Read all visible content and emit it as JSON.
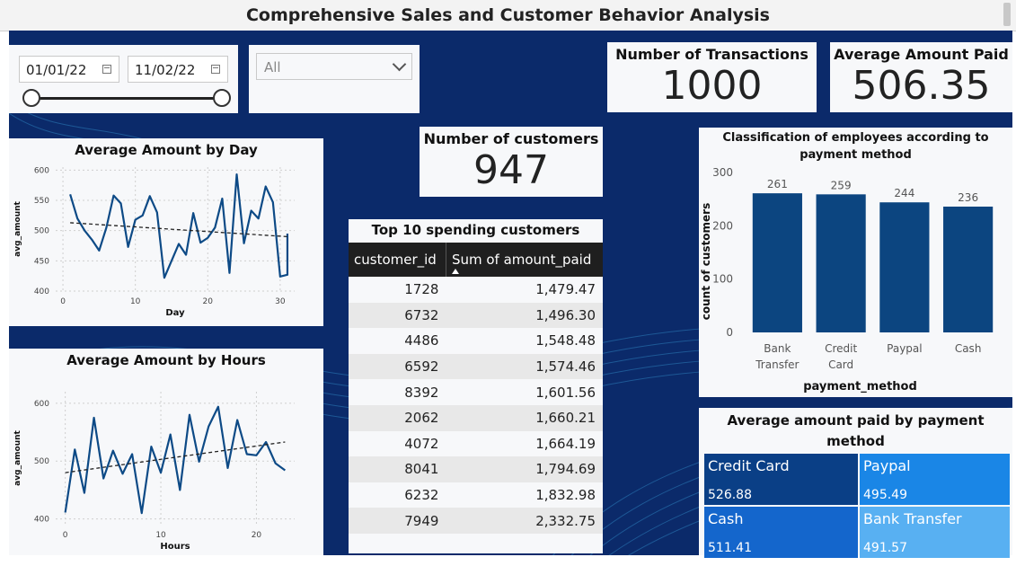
{
  "title": "Comprehensive Sales and Customer Behavior Analysis",
  "colors": {
    "background": "#0b2a6a",
    "series": "#0d4a86",
    "bar": "#0c4580"
  },
  "slicer": {
    "start_date": "01/01/22",
    "end_date": "11/02/22",
    "range_start": 0,
    "range_end": 1,
    "dropdown_value": "All",
    "icons": [
      "calendar-icon",
      "chevron-down-icon"
    ]
  },
  "kpis": {
    "transactions": {
      "label": "Number of Transactions",
      "value": "1000"
    },
    "avg_paid": {
      "label": "Average Amount Paid",
      "value": "506.35"
    },
    "customers": {
      "label": "Number of customers",
      "value": "947"
    }
  },
  "chart_day": {
    "title": "Average Amount by Day",
    "xlabel": "Day",
    "ylabel": "avg_amount",
    "xticks": [
      "0",
      "10",
      "20",
      "30"
    ],
    "yticks": [
      "400",
      "450",
      "500",
      "550",
      "600"
    ]
  },
  "chart_hours": {
    "title": "Average Amount by Hours",
    "xlabel": "Hours",
    "ylabel": "avg_amount",
    "xticks": [
      "0",
      "10",
      "20"
    ],
    "yticks": [
      "400",
      "500",
      "600"
    ]
  },
  "chart_payment": {
    "title": "Classification of employees according to payment method",
    "xlabel": "payment_method",
    "ylabel": "count of customers",
    "yticks": [
      "0",
      "100",
      "200",
      "300"
    ]
  },
  "table": {
    "title": "Top 10 spending customers",
    "headers": [
      "customer_id",
      "Sum of amount_paid"
    ],
    "sort_icon": "sort-ascending-icon",
    "rows": [
      [
        "1728",
        "1,479.47"
      ],
      [
        "6732",
        "1,496.30"
      ],
      [
        "4486",
        "1,548.48"
      ],
      [
        "6592",
        "1,574.46"
      ],
      [
        "8392",
        "1,601.56"
      ],
      [
        "2062",
        "1,660.21"
      ],
      [
        "4072",
        "1,664.19"
      ],
      [
        "8041",
        "1,794.69"
      ],
      [
        "6232",
        "1,832.98"
      ],
      [
        "7949",
        "2,332.75"
      ]
    ]
  },
  "treemap": {
    "title": "Average amount paid by payment method",
    "tiles": [
      {
        "label": "Credit Card",
        "value": "526.88",
        "color": "#0a3f86"
      },
      {
        "label": "Paypal",
        "value": "495.49",
        "color": "#1a86e6"
      },
      {
        "label": "Cash",
        "value": "511.41",
        "color": "#1466cc"
      },
      {
        "label": "Bank Transfer",
        "value": "491.57",
        "color": "#58b0f2"
      }
    ]
  },
  "chart_data": [
    {
      "type": "line",
      "title": "Average Amount by Day",
      "xlabel": "Day",
      "ylabel": "avg_amount",
      "xlim": [
        -1,
        32
      ],
      "ylim": [
        400,
        605
      ],
      "trendline": [
        [
          1,
          513
        ],
        [
          31,
          490
        ]
      ],
      "x": [
        1,
        2,
        3,
        4,
        5,
        6,
        7,
        8,
        9,
        10,
        11,
        12,
        13,
        14,
        15,
        16,
        17,
        18,
        19,
        20,
        21,
        22,
        23,
        24,
        25,
        26,
        27,
        28,
        29,
        30,
        31
      ],
      "series": [
        {
          "values": [
            560,
            520,
            500,
            485,
            467,
            505,
            558,
            545,
            473,
            518,
            525,
            557,
            530,
            422,
            450,
            478,
            460,
            529,
            480,
            488,
            505,
            553,
            430,
            593,
            479,
            533,
            520,
            573,
            547,
            424,
            427,
            495
          ]
        }
      ]
    },
    {
      "type": "line",
      "title": "Average Amount by Hours",
      "xlabel": "Hours",
      "ylabel": "avg_amount",
      "xlim": [
        -1,
        24
      ],
      "ylim": [
        390,
        620
      ],
      "trendline": [
        [
          0,
          480
        ],
        [
          23,
          533
        ]
      ],
      "x": [
        0,
        1,
        2,
        3,
        4,
        5,
        6,
        7,
        8,
        9,
        10,
        11,
        12,
        13,
        14,
        15,
        16,
        17,
        18,
        19,
        20,
        21,
        22,
        23
      ],
      "series": [
        {
          "values": [
            411,
            520,
            445,
            575,
            470,
            518,
            478,
            512,
            410,
            525,
            480,
            546,
            450,
            580,
            499,
            560,
            594,
            488,
            571,
            512,
            510,
            533,
            496,
            484
          ]
        }
      ]
    },
    {
      "type": "bar",
      "title": "Classification of employees according to payment method",
      "xlabel": "payment_method",
      "ylabel": "count of customers",
      "categories": [
        "Bank Transfer",
        "Credit Card",
        "Paypal",
        "Cash"
      ],
      "values": [
        261,
        259,
        244,
        236
      ],
      "ylim": [
        0,
        300
      ]
    }
  ]
}
